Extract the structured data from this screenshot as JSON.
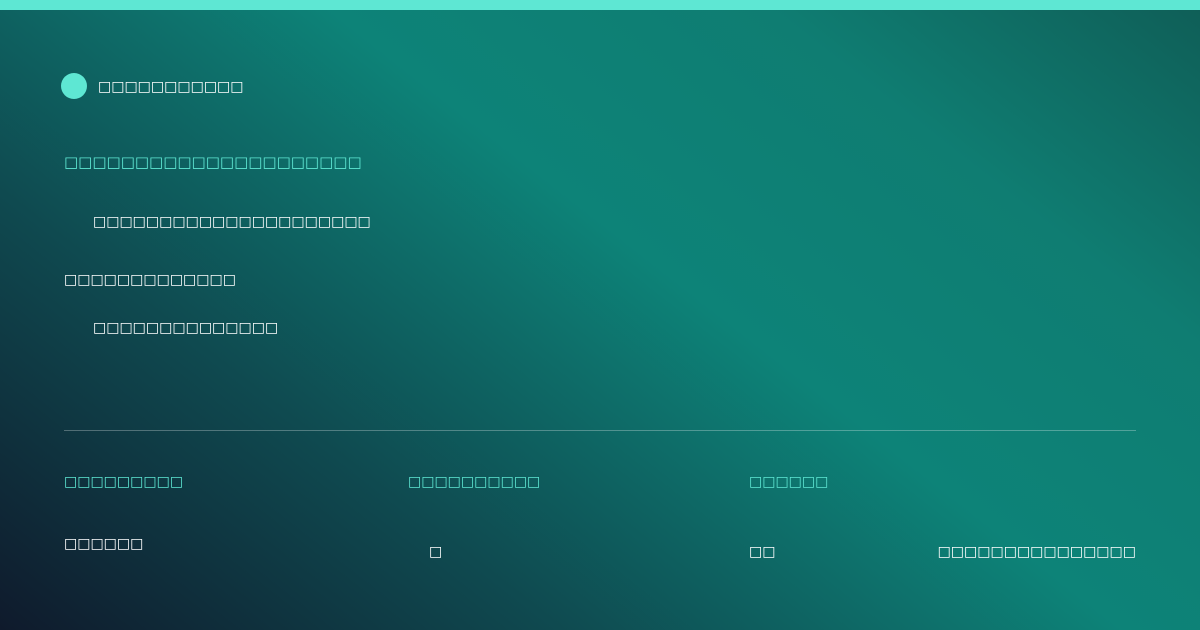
{
  "brand": {
    "name": "□□□□□□□□□□□",
    "accent_color": "#5ee7d3"
  },
  "headline_1": "□□□□□□□□□□□□□□□□□□□□□",
  "subline_1": "□□□□□□□□□□□□□□□□□□□□□",
  "headline_2": "□□□□□□□□□□□□□",
  "subline_2": "□□□□□□□□□□□□□□",
  "footer": {
    "columns": [
      {
        "label": "□□□□□□□□□",
        "value": "□□□□□□"
      },
      {
        "label": "□□□□□□□□□□",
        "value": "□"
      },
      {
        "label": "□□□□□□",
        "value": "□□"
      }
    ],
    "note": "□□□□□□□□□□□□□□□"
  },
  "colors": {
    "accent": "#5ee7d3",
    "background_start": "#0f1a2c",
    "background_mid": "#0d8378",
    "background_end": "#0f5e57"
  }
}
